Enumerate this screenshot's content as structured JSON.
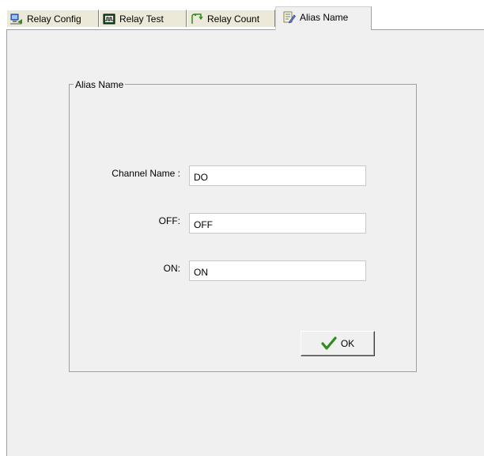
{
  "tabs": [
    {
      "label": "Relay Config",
      "icon": "network-computer-icon"
    },
    {
      "label": "Relay Test",
      "icon": "chip-icon"
    },
    {
      "label": "Relay Count",
      "icon": "counter-icon"
    },
    {
      "label": "Alias Name",
      "icon": "edit-note-icon"
    }
  ],
  "active_tab": "Alias Name",
  "group": {
    "title": "Alias Name"
  },
  "fields": {
    "channel_name": {
      "label": "Channel Name :",
      "value": "DO"
    },
    "off": {
      "label": "OFF:",
      "value": "OFF"
    },
    "on": {
      "label": "ON:",
      "value": "ON"
    }
  },
  "ok_button": {
    "label": "OK",
    "icon": "checkmark-icon"
  },
  "colors": {
    "panel_bg": "#f0f0f0",
    "check_green": "#2e8b1e"
  }
}
